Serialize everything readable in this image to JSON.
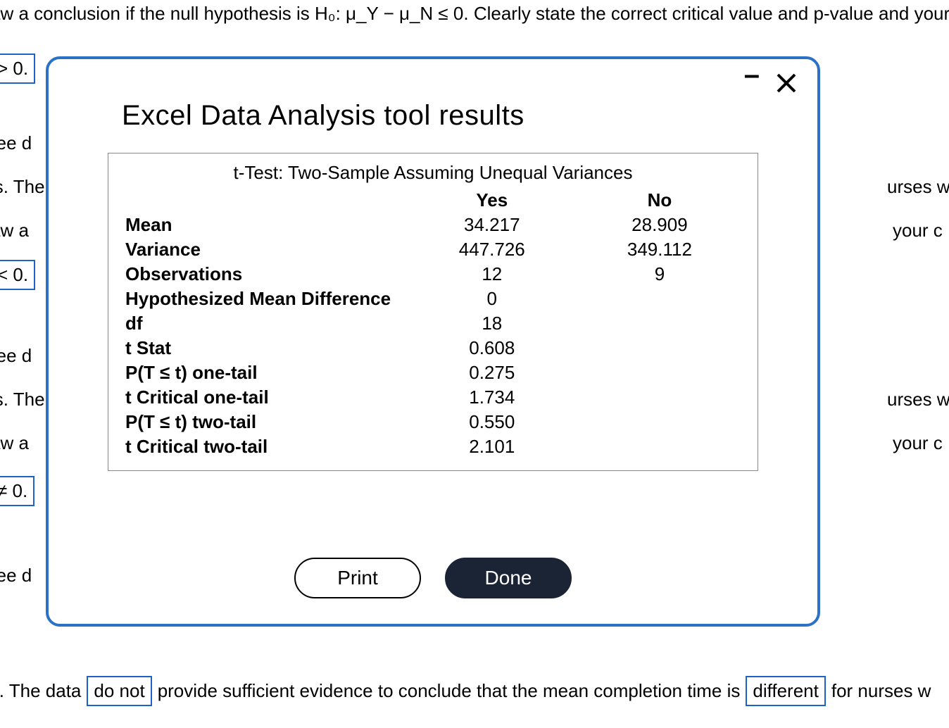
{
  "background": {
    "top_line": "aw a conclusion if the null hypothesis is H₀: μ_Y − μ_N ≤ 0. Clearly state the correct critical value and p-value and your c",
    "box1": "> 0.",
    "frag_ree_d_1": "ree d",
    "frag_is_the_1": "is. The",
    "frag_aw_a_1": "aw a ",
    "box2": "< 0.",
    "frag_urses_w_1": "urses w",
    "frag_your_c_1": " your c",
    "frag_ree_d_2": "ree d",
    "frag_is_the_2": "is. The",
    "frag_aw_a_2": "aw a ",
    "box3": "≠ 0.",
    "frag_urses_w_2": "urses w",
    "frag_your_c_2": " your c",
    "frag_ree_d_3": "ree d",
    "sentence_lead": "is. The data",
    "sentence_box1": "do not",
    "sentence_mid": "provide sufficient evidence to conclude that the mean completion time is",
    "sentence_box2": "different",
    "sentence_tail": "for nurses w"
  },
  "modal": {
    "title": "Excel Data Analysis tool results",
    "caption": "t-Test: Two-Sample Assuming Unequal Variances",
    "col1": "Yes",
    "col2": "No",
    "rows": {
      "mean": {
        "label": "Mean",
        "yes": "34.217",
        "no": "28.909"
      },
      "variance": {
        "label": "Variance",
        "yes": "447.726",
        "no": "349.112"
      },
      "obs": {
        "label": "Observations",
        "yes": "12",
        "no": "9"
      },
      "hmd": {
        "label": "Hypothesized Mean Difference",
        "yes": "0",
        "no": ""
      },
      "df": {
        "label": "df",
        "yes": "18",
        "no": ""
      },
      "tstat": {
        "label": "t Stat",
        "yes": "0.608",
        "no": ""
      },
      "p1": {
        "label": "P(T ≤ t) one-tail",
        "yes": "0.275",
        "no": ""
      },
      "tc1": {
        "label": "t Critical one-tail",
        "yes": "1.734",
        "no": ""
      },
      "p2": {
        "label": "P(T ≤ t) two-tail",
        "yes": "0.550",
        "no": ""
      },
      "tc2": {
        "label": "t Critical two-tail",
        "yes": "2.101",
        "no": ""
      }
    },
    "print": "Print",
    "done": "Done"
  }
}
